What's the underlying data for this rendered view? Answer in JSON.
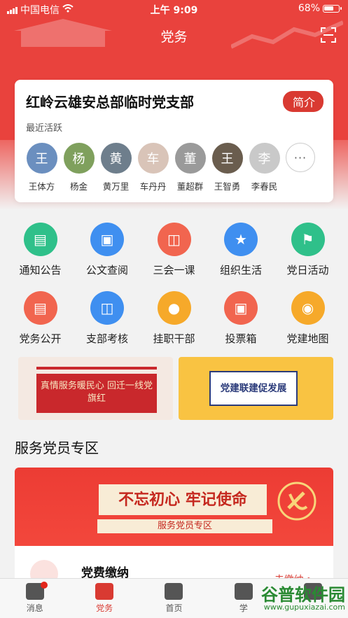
{
  "status_bar": {
    "carrier": "中国电信",
    "time": "上午 9:09",
    "battery": "68%",
    "battery_level": 0.68
  },
  "nav": {
    "title": "党务"
  },
  "branch_card": {
    "title": "红岭云雄安总部临时党支部",
    "intro_label": "简介",
    "recent_label": "最近活跃",
    "members": [
      {
        "name": "王体方",
        "avatar": "王"
      },
      {
        "name": "杨金",
        "avatar": "杨"
      },
      {
        "name": "黄万里",
        "avatar": "黄"
      },
      {
        "name": "车丹丹",
        "avatar": "车"
      },
      {
        "name": "董超群",
        "avatar": "董"
      },
      {
        "name": "王智勇",
        "avatar": "王"
      },
      {
        "name": "李春民",
        "avatar": "李"
      }
    ],
    "more_label": "···"
  },
  "features": [
    {
      "label": "通知公告",
      "color": "#2fc08a",
      "icon": "notice-icon"
    },
    {
      "label": "公文查阅",
      "color": "#3f8ff0",
      "icon": "briefcase-icon"
    },
    {
      "label": "三会一课",
      "color": "#f1654f",
      "icon": "presentation-icon"
    },
    {
      "label": "组织生活",
      "color": "#3f8ff0",
      "icon": "star-icon"
    },
    {
      "label": "党日活动",
      "color": "#2fc08a",
      "icon": "flag-icon"
    },
    {
      "label": "党务公开",
      "color": "#f1654f",
      "icon": "document-icon"
    },
    {
      "label": "支部考核",
      "color": "#3f8ff0",
      "icon": "assessment-icon"
    },
    {
      "label": "挂职干部",
      "color": "#f6a92a",
      "icon": "person-icon"
    },
    {
      "label": "投票箱",
      "color": "#f1654f",
      "icon": "ballot-icon"
    },
    {
      "label": "党建地图",
      "color": "#f6a92a",
      "icon": "map-pin-icon"
    }
  ],
  "banners": {
    "left_text": "真情服务暖民心 回迁一线党旗红",
    "right_text": "党建联建促发展"
  },
  "service_zone": {
    "title": "服务党员专区",
    "slogan": "不忘初心 牢记使命",
    "subtitle": "服务党员专区"
  },
  "fee": {
    "name": "党费缴纳",
    "status": "未缴纳 >"
  },
  "tabbar": [
    {
      "label": "消息",
      "color": "#555555"
    },
    {
      "label": "党务",
      "color": "#d93a32"
    },
    {
      "label": "首页",
      "color": "#555555"
    },
    {
      "label": "学",
      "color": "#555555"
    },
    {
      "label": "",
      "color": "#555555"
    }
  ],
  "watermark": {
    "text": "谷普软件园",
    "url": "www.gupuxiazai.com"
  }
}
